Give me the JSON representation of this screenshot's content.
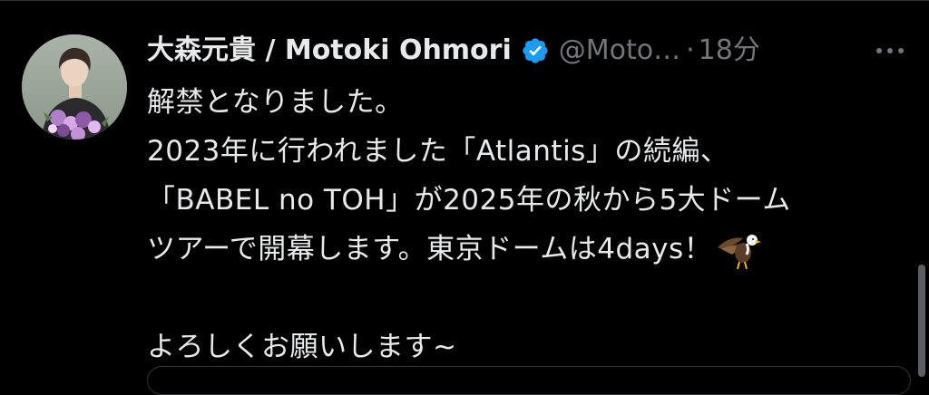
{
  "tweet": {
    "author": {
      "display_name": "大森元貴 / Motoki Ohmori",
      "handle": "@Moto…",
      "verified": true
    },
    "separator": "·",
    "timestamp": "18分",
    "text_lines": [
      "解禁となりました。",
      "2023年に行われました「Atlantis」の続編、",
      "「BABEL no TOH」が2025年の秋から5大ドーム",
      "ツアーで開幕します。東京ドームは4days！",
      "",
      "よろしくお願いします~"
    ],
    "emoji": "eagle-emoji"
  },
  "colors": {
    "background": "#000000",
    "text_primary": "#e7e9ea",
    "text_secondary": "#71767b",
    "verified_blue": "#1d9bf0",
    "scrollbar": "#5b5e62"
  },
  "icons": {
    "verified": "verified-badge-icon",
    "more": "more-dots-icon"
  }
}
